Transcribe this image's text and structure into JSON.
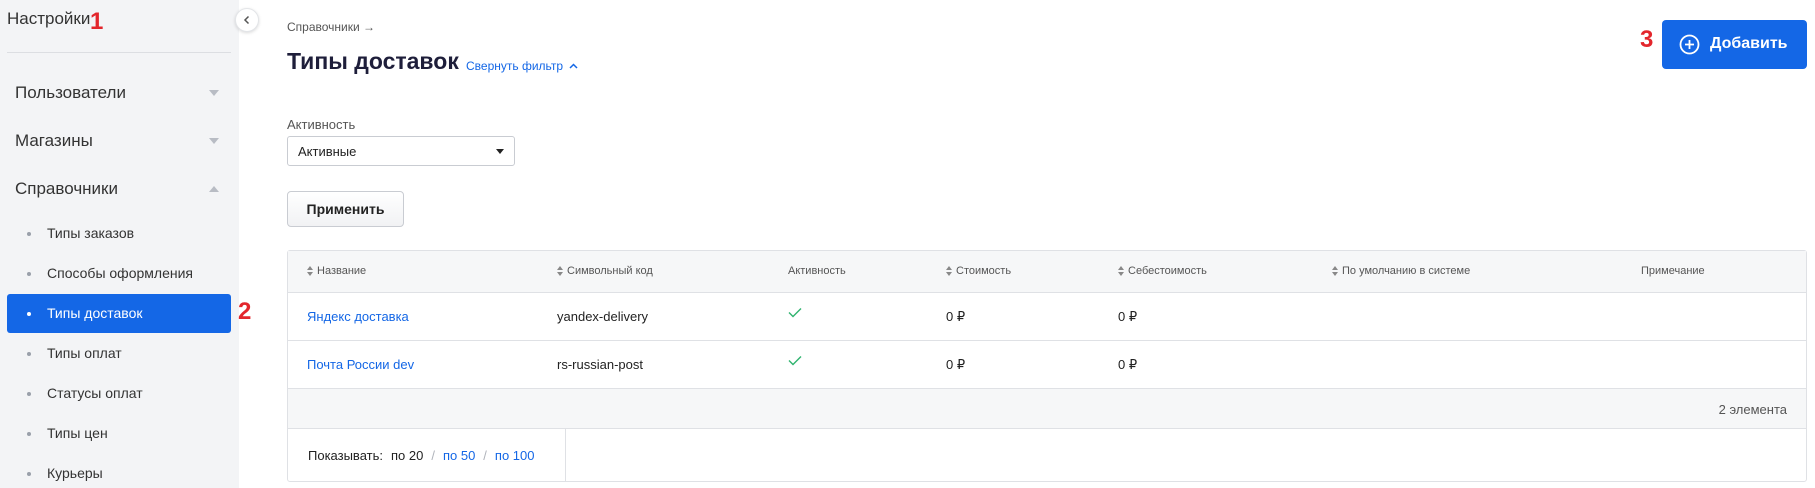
{
  "sidebar": {
    "title": "Настройки",
    "groups": [
      {
        "label": "Пользователи"
      },
      {
        "label": "Магазины"
      },
      {
        "label": "Справочники"
      }
    ],
    "items": [
      {
        "label": "Типы заказов"
      },
      {
        "label": "Способы оформления"
      },
      {
        "label": "Типы доставок"
      },
      {
        "label": "Типы оплат"
      },
      {
        "label": "Статусы оплат"
      },
      {
        "label": "Типы цен"
      },
      {
        "label": "Курьеры"
      }
    ],
    "active_item": "Типы доставок"
  },
  "markers": {
    "m1": "1",
    "m2": "2",
    "m3": "3"
  },
  "header": {
    "breadcrumb": "Справочники →",
    "title": "Типы доставок",
    "collapse_filter": "Свернуть фильтр",
    "add_button": "Добавить"
  },
  "filter": {
    "label": "Активность",
    "selected": "Активные",
    "apply": "Применить"
  },
  "table": {
    "columns": [
      "Название",
      "Символьный код",
      "Активность",
      "Стоимость",
      "Себестоимость",
      "По умолчанию в системе",
      "Примечание"
    ],
    "rows": [
      {
        "name": "Яндекс доставка",
        "code": "yandex-delivery",
        "active": true,
        "cost": "0 ₽",
        "self_cost": "0 ₽",
        "default": "",
        "note": ""
      },
      {
        "name": "Почта России dev",
        "code": "rs-russian-post",
        "active": true,
        "cost": "0 ₽",
        "self_cost": "0 ₽",
        "default": "",
        "note": ""
      }
    ],
    "count": "2 элемента",
    "pager": {
      "label": "Показывать:",
      "current": "по 20",
      "options": [
        "по 50",
        "по 100"
      ]
    }
  },
  "colors": {
    "accent": "#1467e6",
    "marker": "#e3262c",
    "check": "#2fb36e"
  }
}
